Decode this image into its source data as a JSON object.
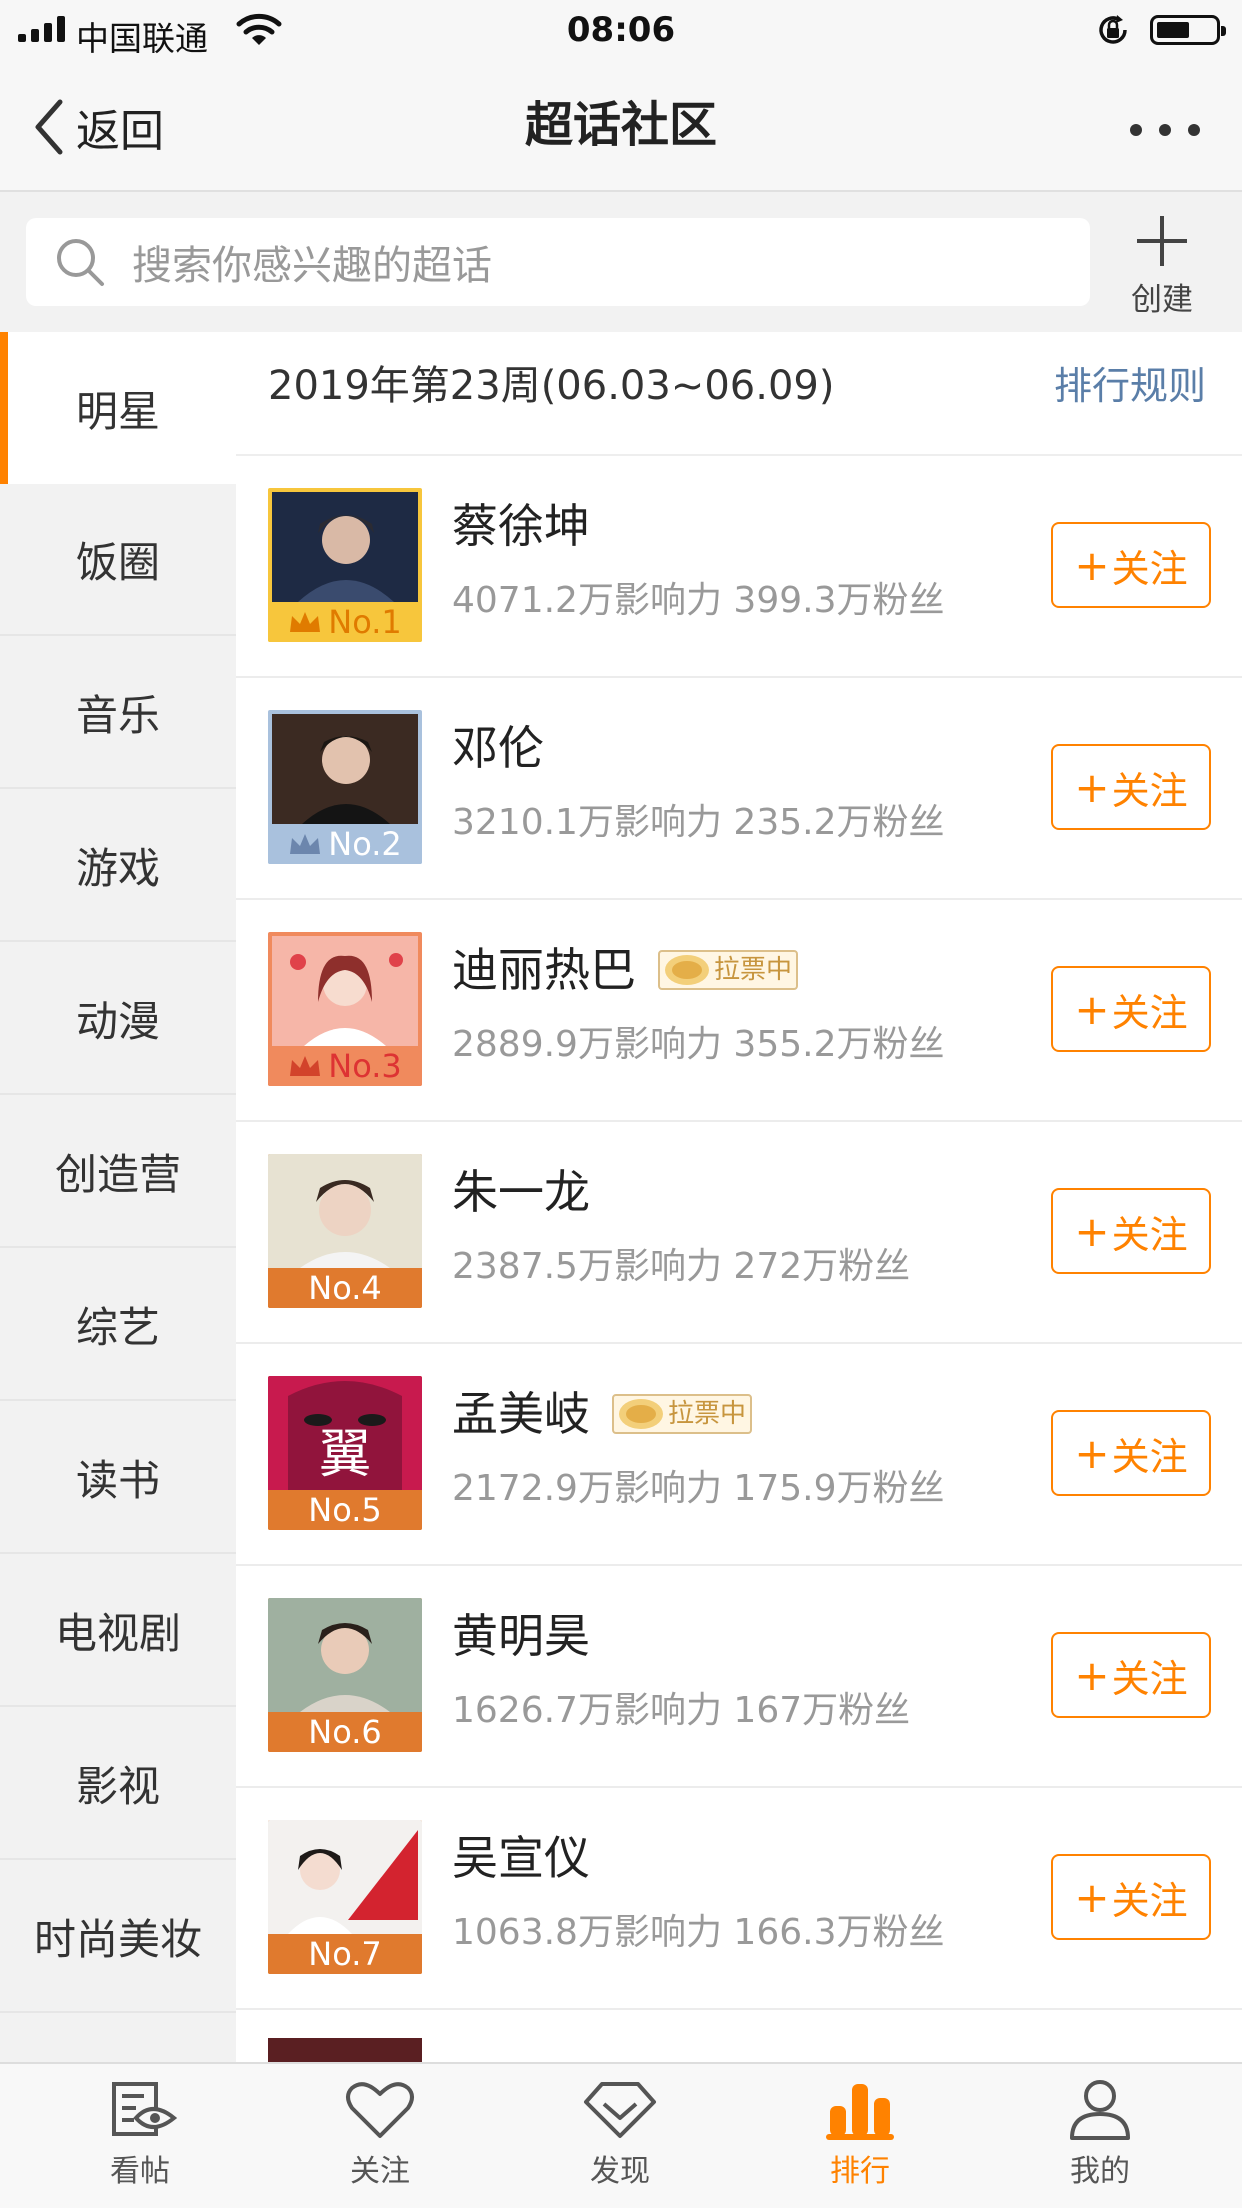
{
  "status_bar": {
    "carrier": "中国联通",
    "time": "08:06"
  },
  "nav": {
    "back_label": "返回",
    "title": "超话社区"
  },
  "search": {
    "placeholder": "搜索你感兴趣的超话",
    "create_label": "创建"
  },
  "categories": [
    {
      "label": "明星",
      "active": true
    },
    {
      "label": "饭圈"
    },
    {
      "label": "音乐"
    },
    {
      "label": "游戏"
    },
    {
      "label": "动漫"
    },
    {
      "label": "创造营"
    },
    {
      "label": "综艺"
    },
    {
      "label": "读书"
    },
    {
      "label": "电视剧"
    },
    {
      "label": "影视"
    },
    {
      "label": "时尚美妆"
    }
  ],
  "ranking": {
    "week_label": "2019年第23周(06.03~06.09)",
    "rule_link": "排行规则",
    "follow_label": "关注",
    "items": [
      {
        "rank": "No.1",
        "name": "蔡徐坤",
        "stats": "4071.2万影响力 399.3万粉丝",
        "badge": ""
      },
      {
        "rank": "No.2",
        "name": "邓伦",
        "stats": "3210.1万影响力 235.2万粉丝",
        "badge": ""
      },
      {
        "rank": "No.3",
        "name": "迪丽热巴",
        "stats": "2889.9万影响力 355.2万粉丝",
        "badge": "拉票中"
      },
      {
        "rank": "No.4",
        "name": "朱一龙",
        "stats": "2387.5万影响力 272万粉丝",
        "badge": ""
      },
      {
        "rank": "No.5",
        "name": "孟美岐",
        "stats": "2172.9万影响力 175.9万粉丝",
        "badge": "拉票中"
      },
      {
        "rank": "No.6",
        "name": "黄明昊",
        "stats": "1626.7万影响力 167万粉丝",
        "badge": ""
      },
      {
        "rank": "No.7",
        "name": "吴宣仪",
        "stats": "1063.8万影响力 166.3万粉丝",
        "badge": ""
      }
    ]
  },
  "tabs": [
    {
      "label": "看帖",
      "icon": "eye-post-icon"
    },
    {
      "label": "关注",
      "icon": "heart-icon"
    },
    {
      "label": "发现",
      "icon": "diamond-icon"
    },
    {
      "label": "排行",
      "icon": "bar-chart-icon",
      "active": true
    },
    {
      "label": "我的",
      "icon": "person-icon"
    }
  ],
  "colors": {
    "accent": "#ff8200",
    "link": "#5a7ea8",
    "gold": "#f7c63c",
    "silver": "#a9c1dd",
    "bronze": "#f08a5d"
  }
}
